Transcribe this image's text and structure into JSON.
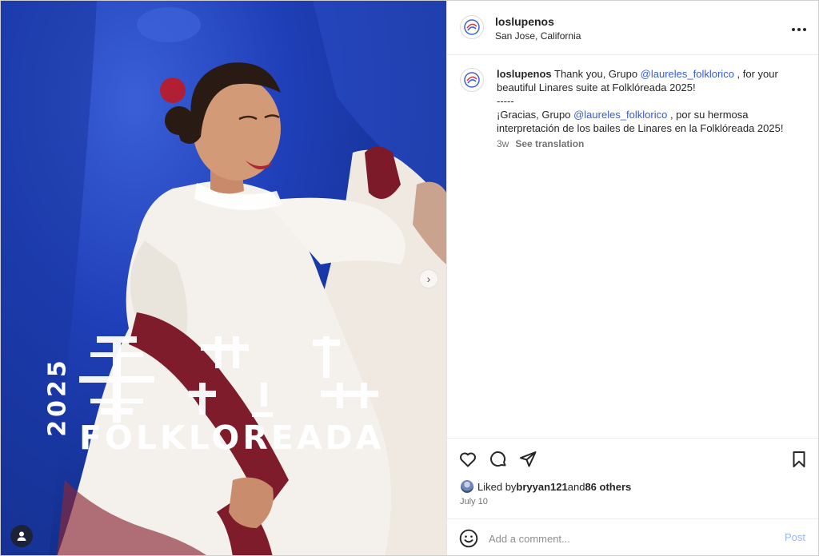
{
  "post": {
    "username": "loslupenos",
    "location": "San Jose, California"
  },
  "media": {
    "overlay_year": "2025",
    "overlay_word": "FOLKLOREADA"
  },
  "caption": {
    "username": "loslupenos",
    "line1_a": " Thank you, Grupo ",
    "mention_1": "@laureles_folklorico",
    "line1_b": " , for your beautiful Linares suite at Folklóreada 2025!",
    "separator": "-----",
    "line2_a": "¡Gracias, Grupo ",
    "mention_2": "@laureles_folklorico",
    "line2_b": " , por su hermosa interpretación de los bailes de Linares en la Folklóreada 2025!",
    "age": "3w",
    "see_translation": "See translation"
  },
  "likes": {
    "prefix": "Liked by ",
    "first_liker": "bryyan121",
    "middle": " and ",
    "others": "86 others"
  },
  "date": "July 10",
  "comment": {
    "placeholder": "Add a comment...",
    "post_label": "Post"
  },
  "icons": {
    "like": "heart-icon",
    "comment": "comment-bubble-icon",
    "share": "paper-plane-icon",
    "save": "bookmark-icon",
    "more": "more-dots-icon",
    "emoji": "emoji-smile-icon",
    "tag": "user-tag-icon",
    "next": "chevron-right-icon"
  },
  "colors": {
    "mention": "#385bd6",
    "post_disabled": "#9db4f5",
    "backdrop": "#1f3fb8",
    "dress": "#f4f1ec",
    "sash": "#7e1c2c"
  }
}
